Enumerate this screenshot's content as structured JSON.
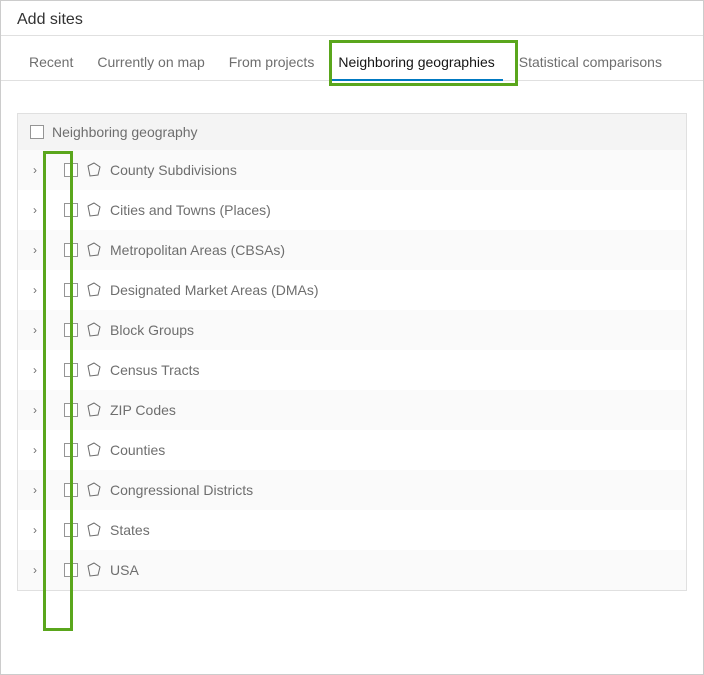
{
  "title": "Add sites",
  "tabs": [
    {
      "label": "Recent",
      "active": false
    },
    {
      "label": "Currently on map",
      "active": false
    },
    {
      "label": "From projects",
      "active": false
    },
    {
      "label": "Neighboring geographies",
      "active": true
    },
    {
      "label": "Statistical comparisons",
      "active": false
    }
  ],
  "section": {
    "header": "Neighboring geography",
    "items": [
      {
        "label": "County Subdivisions"
      },
      {
        "label": "Cities and Towns (Places)"
      },
      {
        "label": "Metropolitan Areas (CBSAs)"
      },
      {
        "label": "Designated Market Areas (DMAs)"
      },
      {
        "label": "Block Groups"
      },
      {
        "label": "Census Tracts"
      },
      {
        "label": "ZIP Codes"
      },
      {
        "label": "Counties"
      },
      {
        "label": "Congressional Districts"
      },
      {
        "label": "States"
      },
      {
        "label": "USA"
      }
    ]
  }
}
